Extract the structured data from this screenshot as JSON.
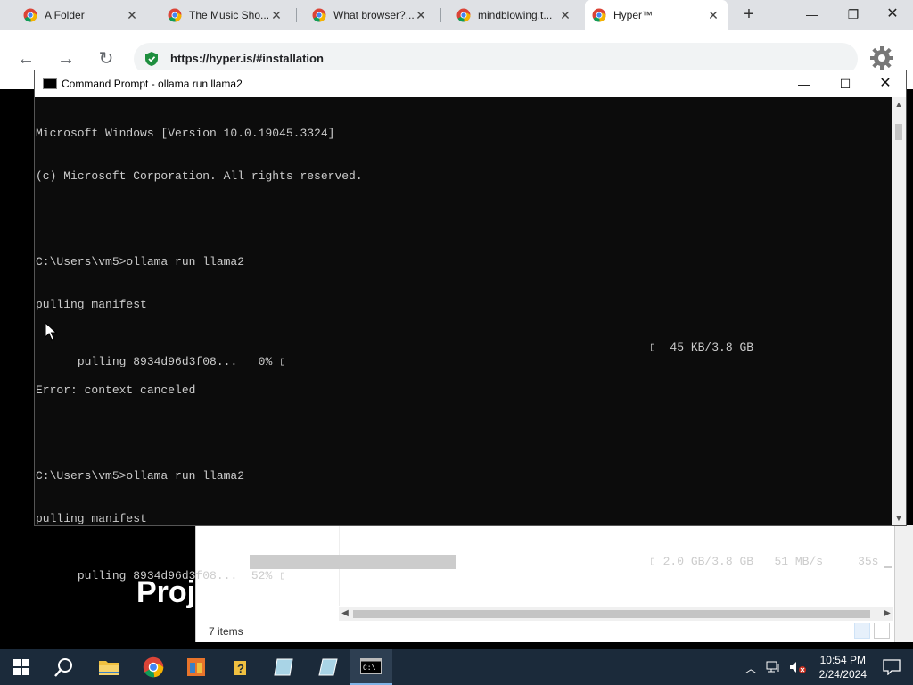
{
  "browser": {
    "tabs": [
      {
        "title": "A Folder",
        "active": false
      },
      {
        "title": "The Music Sho...",
        "active": false
      },
      {
        "title": "What  browser?...",
        "active": false
      },
      {
        "title": "mindblowing.t...",
        "active": false
      },
      {
        "title": "Hyper™",
        "active": true
      }
    ],
    "url": "https://hyper.is/#installation"
  },
  "page": {
    "heading_fragment": "Proj"
  },
  "explorer": {
    "status": "7 items"
  },
  "cmd": {
    "title": "Command Prompt - ollama  run llama2",
    "lines": [
      "Microsoft Windows [Version 10.0.19045.3324]",
      "(c) Microsoft Corporation. All rights reserved.",
      "",
      "C:\\Users\\vm5>ollama run llama2",
      "pulling manifest",
      "pulling 8934d96d3f08...   0% ▯",
      "Error: context canceled",
      "",
      "C:\\Users\\vm5>ollama run llama2",
      "pulling manifest",
      "pulling 8934d96d3f08...  52% ▯"
    ],
    "progress1": {
      "right": "▯  45 KB/3.8 GB",
      "fraction": 0.0
    },
    "progress2": {
      "right": "▯ 2.0 GB/3.8 GB   51 MB/s     35s",
      "fraction": 0.52
    }
  },
  "taskbar": {
    "time": "10:54 PM",
    "date": "2/24/2024"
  }
}
